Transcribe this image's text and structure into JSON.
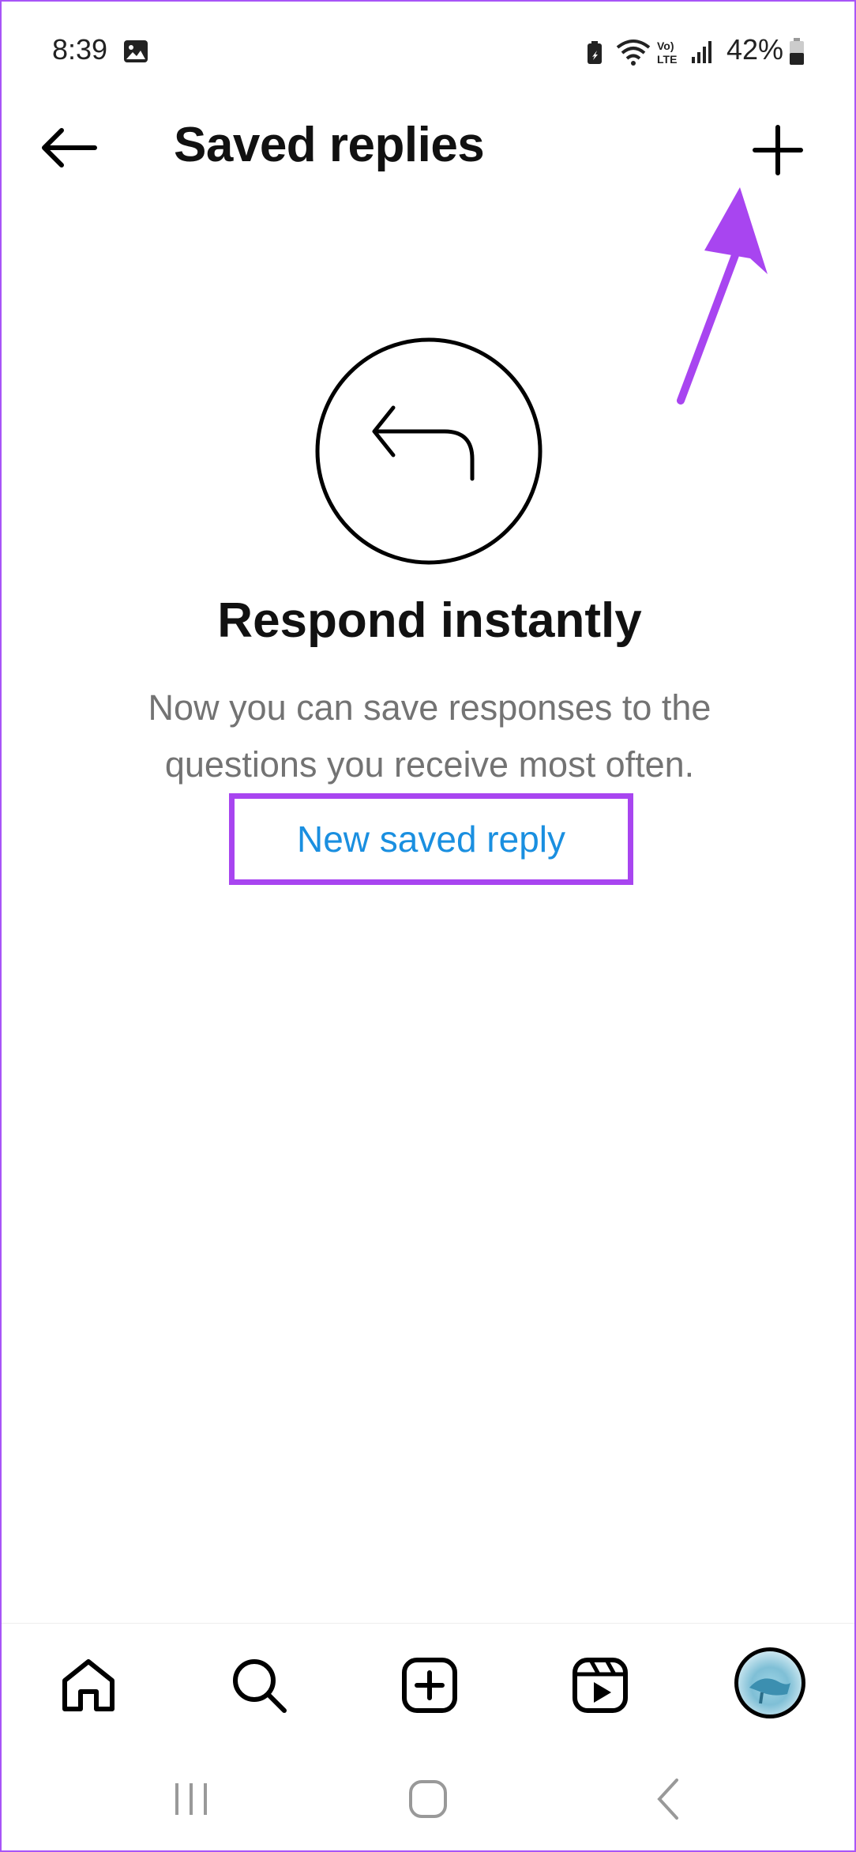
{
  "status_bar": {
    "time": "8:39",
    "battery_percent": "42%",
    "icons": [
      "gallery-icon",
      "battery-saver-icon",
      "wifi-icon",
      "volte-icon",
      "signal-icon",
      "battery-icon"
    ]
  },
  "header": {
    "title": "Saved replies",
    "back_icon": "back-arrow-icon",
    "add_icon": "plus-icon"
  },
  "empty_state": {
    "icon": "reply-arrow-icon",
    "title": "Respond instantly",
    "description": "Now you can save responses to the questions you receive most often.",
    "action_label": "New saved reply"
  },
  "bottom_nav": {
    "items": [
      "home-icon",
      "search-icon",
      "create-icon",
      "reels-icon",
      "profile-avatar"
    ]
  },
  "system_nav": {
    "items": [
      "recents-icon",
      "home-button-icon",
      "back-icon"
    ]
  },
  "colors": {
    "accent_highlight": "#a845f0",
    "link": "#1a8fe0",
    "secondary_text": "#737373"
  }
}
